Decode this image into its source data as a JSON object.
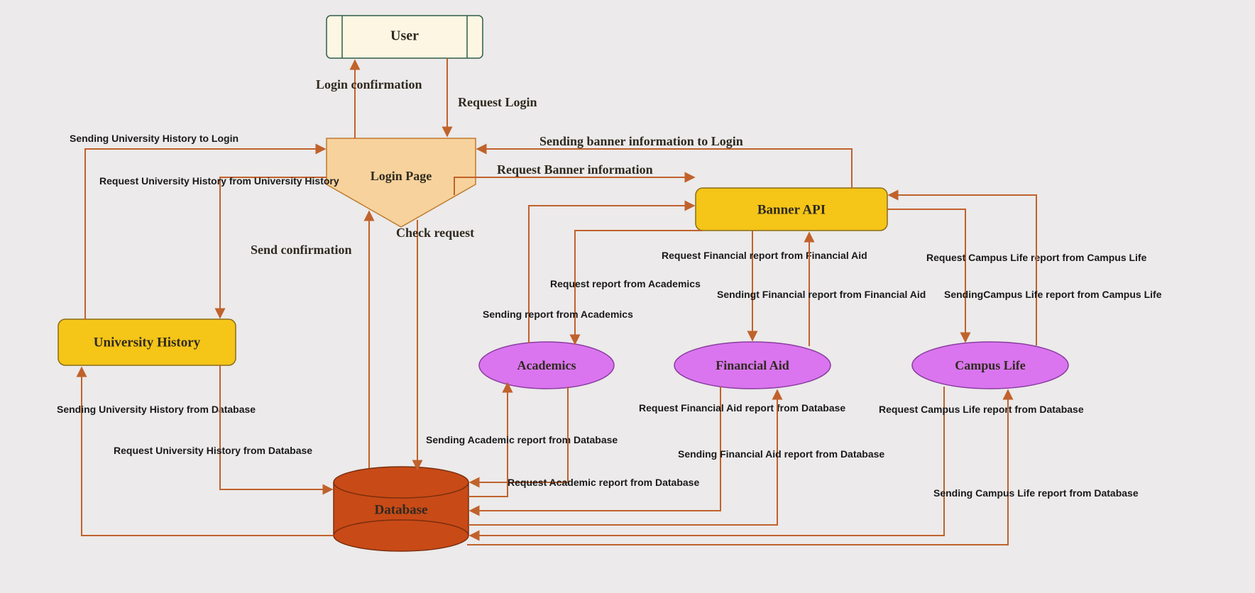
{
  "nodes": {
    "user": "User",
    "loginPage": "Login Page",
    "universityHistory": "University History",
    "bannerApi": "Banner API",
    "academics": "Academics",
    "financialAid": "Financial Aid",
    "campusLife": "Campus Life",
    "database": "Database"
  },
  "edges": {
    "loginConfirmation": "Login confirmation",
    "requestLogin": "Request Login",
    "sendConfirmation": "Send confirmation",
    "checkRequest": "Check request",
    "sendingUHtoLogin": "Sending  University History  to Login",
    "requestUHfromUH": "Request  University History  from  University History",
    "sendingUHfromDB": "Sending  University History  from  Database",
    "requestUHfromDB": "Request  University History  from  Database",
    "sendingBannerToLogin": "Sending banner information to Login",
    "requestBannerInfo": "Request Banner information",
    "requestReportAcademics": "Request report  from Academics",
    "sendingReportAcademics": "Sending  report  from Academics",
    "requestFinReportFA": "Request Financial report from Financial Aid",
    "sendingFinReportFA": "Sendingt Financial report from Financial Aid",
    "requestCLreportCL": "Request  Campus Life report from Campus Life",
    "sendingCLreportCL": "SendingCampus Life report from Campus Life",
    "sendingAcadFromDB": "Sending Academic report from Database",
    "requestAcadFromDB": "Request Academic report from Database",
    "requestFinAidFromDB": "Request Financial Aid report from Database",
    "sendingFinAidFromDB": "Sending Financial Aid  report from  Database",
    "requestCLfromDB": "Request  Campus Life report from Database",
    "sendingCLfromDB": "Sending  Campus Life report from Database"
  }
}
